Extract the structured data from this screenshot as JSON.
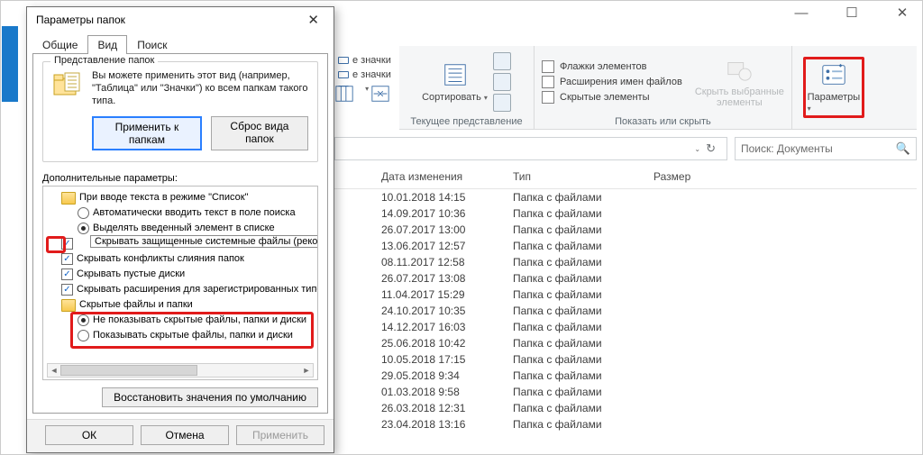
{
  "window": {
    "win_min": "—",
    "win_max": "☐",
    "win_close": "✕"
  },
  "ribbon": {
    "frag1": "е значки",
    "frag2": "е значки",
    "group_layout_cap": "Текущее представление",
    "sort_label": "Сортировать",
    "group_show_cap": "Показать или скрыть",
    "chk_flags": "Флажки элементов",
    "chk_ext": "Расширения имен файлов",
    "chk_hidden": "Скрытые элементы",
    "hide_sel": "Скрыть выбранные\nэлементы",
    "options": "Параметры"
  },
  "addr": {
    "search_placeholder": "Поиск: Документы"
  },
  "columns": {
    "date": "Дата изменения",
    "type": "Тип",
    "size": "Размер"
  },
  "type_value": "Папка с файлами",
  "rows": [
    "10.01.2018 14:15",
    "14.09.2017 10:36",
    "26.07.2017 13:00",
    "13.06.2017 12:57",
    "08.11.2017 12:58",
    "26.07.2017 13:08",
    "11.04.2017 15:29",
    "24.10.2017 10:35",
    "14.12.2017 16:03",
    "25.06.2018 10:42",
    "10.05.2018 17:15",
    "29.05.2018 9:34",
    "01.03.2018 9:58",
    "26.03.2018 12:31",
    "23.04.2018 13:16"
  ],
  "dialog": {
    "title": "Параметры папок",
    "tabs": {
      "general": "Общие",
      "view": "Вид",
      "search": "Поиск"
    },
    "fv_legend": "Представление папок",
    "fv_text": "Вы можете применить этот вид (например, \"Таблица\" или \"Значки\") ко всем папкам такого типа.",
    "btn_apply_folders": "Применить к папкам",
    "btn_reset_folders": "Сброс вида папок",
    "adv_label": "Дополнительные параметры:",
    "tree": {
      "n1": "При вводе текста в режиме \"Список\"",
      "n1a": "Автоматически вводить текст в поле поиска",
      "n1b": "Выделять введенный элемент в списке",
      "n2_tooltip": "Скрывать защищенные системные файлы (рекомендуется)",
      "n3": "Скрывать конфликты слияния папок",
      "n4": "Скрывать пустые диски",
      "n5": "Скрывать расширения для зарегистрированных типо",
      "n6": "Скрытые файлы и папки",
      "n6a": "Не показывать скрытые файлы, папки и диски",
      "n6b": "Показывать скрытые файлы, папки и диски"
    },
    "btn_restore": "Восстановить значения по умолчанию",
    "btn_ok": "ОК",
    "btn_cancel": "Отмена",
    "btn_apply": "Применить"
  }
}
